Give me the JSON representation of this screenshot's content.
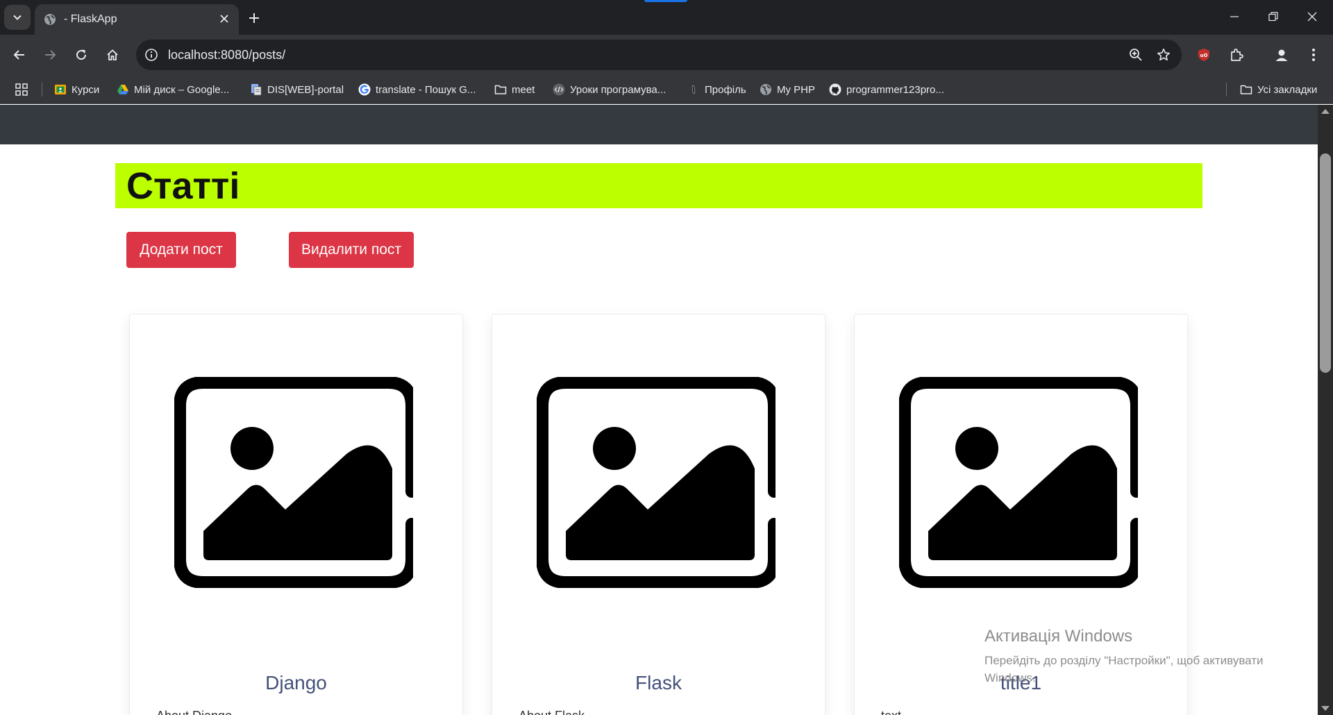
{
  "browser": {
    "tab_title": "- FlaskApp",
    "url": "localhost:8080/posts/",
    "icons": [
      "tab-search-icon",
      "globe-icon",
      "close-icon",
      "plus-icon",
      "minimize-icon",
      "restore-icon",
      "close-window-icon",
      "back-arrow-icon",
      "forward-arrow-icon",
      "reload-icon",
      "home-icon",
      "site-info-icon",
      "zoom-icon",
      "star-icon",
      "ublock-icon",
      "extensions-icon",
      "profile-icon",
      "more-menu-icon"
    ]
  },
  "bookmarks": {
    "items": [
      {
        "label": "Курси",
        "icon": "classroom-icon"
      },
      {
        "label": "Мій диск – Google...",
        "icon": "google-drive-icon"
      },
      {
        "label": "DIS[WEB]-portal",
        "icon": "portal-icon"
      },
      {
        "label": "translate - Пошук G...",
        "icon": "google-icon"
      },
      {
        "label": "meet",
        "icon": "folder-icon"
      },
      {
        "label": "Уроки програмува...",
        "icon": "code-icon"
      },
      {
        "label": "Профіль",
        "icon": "profile-bookmark-icon"
      },
      {
        "label": "My PHP",
        "icon": "globe-icon"
      },
      {
        "label": "programmer123pro...",
        "icon": "github-icon"
      }
    ],
    "all_bookmarks": "Усі закладки"
  },
  "page": {
    "title": "Статті",
    "add_button": "Додати пост",
    "delete_button": "Видалити пост",
    "posts": [
      {
        "title": "Django",
        "text": "About Django"
      },
      {
        "title": "Flask",
        "text": "About Flask"
      },
      {
        "title": "title1",
        "text": "text"
      }
    ],
    "colors": {
      "title_bar": "#bbff00",
      "danger": "#dc3545",
      "navbar": "#343a40"
    }
  },
  "watermark": {
    "title": "Активація Windows",
    "subtitle": "Перейдіть до розділу \"Настройки\", щоб активувати Windows."
  }
}
